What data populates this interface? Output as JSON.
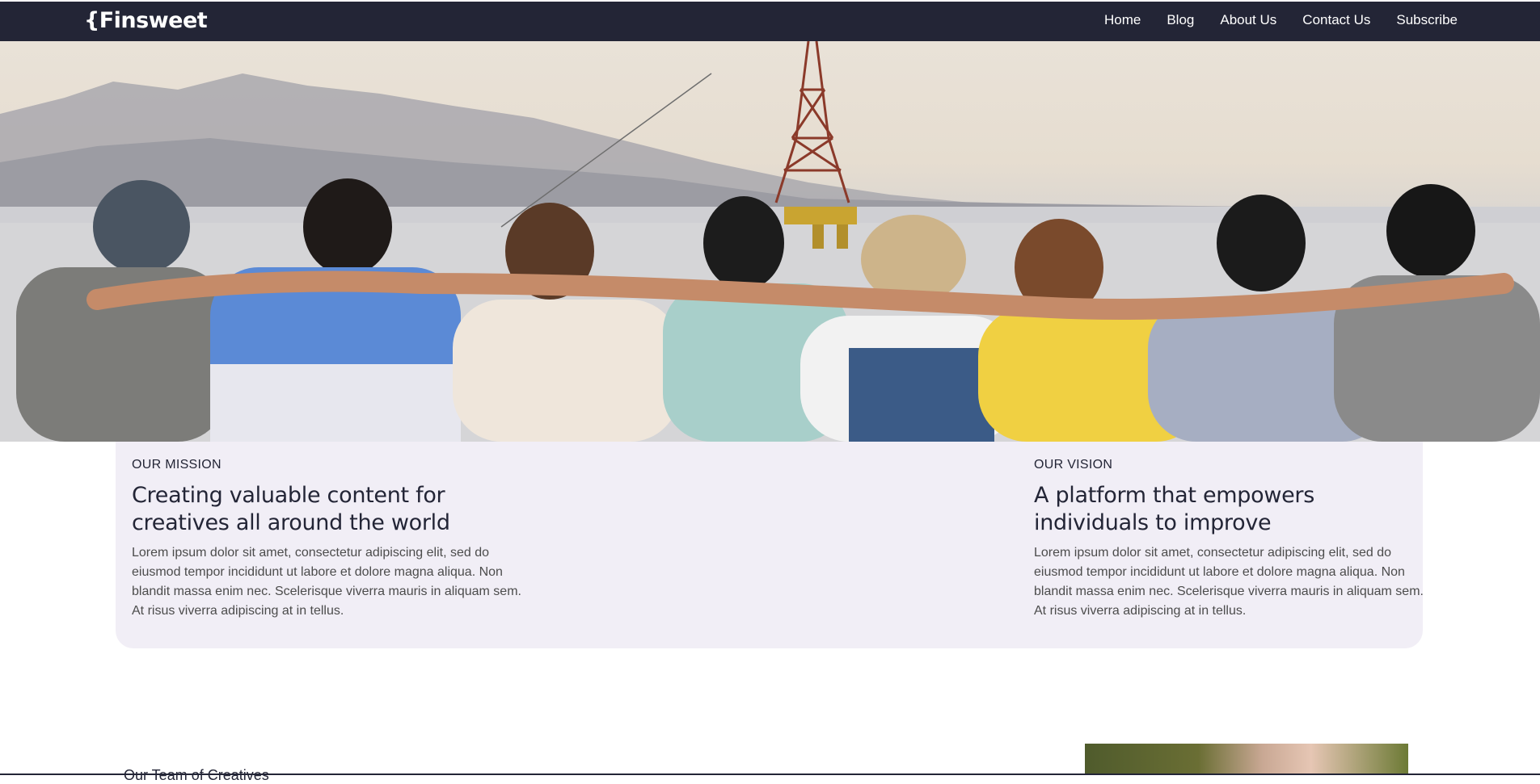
{
  "brand": {
    "name": "{Finsweet"
  },
  "nav": {
    "items": [
      {
        "label": "Home"
      },
      {
        "label": "Blog"
      },
      {
        "label": "About Us"
      },
      {
        "label": "Contact Us"
      },
      {
        "label": "Subscribe"
      }
    ]
  },
  "mission": {
    "eyebrow": "OUR MISSION",
    "heading_line1": "Creating valuable content for",
    "heading_line2": "creatives all around the world",
    "body": "Lorem ipsum dolor sit amet, consectetur adipiscing elit, sed do eiusmod tempor incididunt ut labore et dolore magna aliqua. Non blandit massa enim nec. Scelerisque viverra mauris in aliquam sem. At risus viverra adipiscing at in tellus."
  },
  "vision": {
    "eyebrow": "OUR VISION",
    "heading_line1": "A platform that empowers",
    "heading_line2": "individuals to improve",
    "body": "Lorem ipsum dolor sit amet, consectetur adipiscing elit, sed do eiusmod tempor incididunt ut labore et dolore magna aliqua. Non blandit massa enim nec. Scelerisque viverra mauris in aliquam sem. At risus viverra adipiscing at in tellus."
  },
  "team": {
    "heading": "Our Team of Creatives"
  },
  "colors": {
    "navbar": "#232536",
    "card_background": "#f1eef6",
    "text_dark": "#232536",
    "text_body": "#4c4c4c"
  }
}
